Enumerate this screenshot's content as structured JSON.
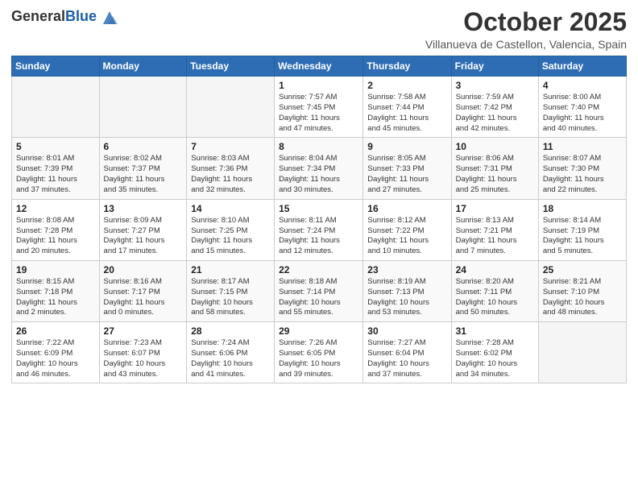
{
  "logo": {
    "general": "General",
    "blue": "Blue"
  },
  "header": {
    "month": "October 2025",
    "location": "Villanueva de Castellon, Valencia, Spain"
  },
  "weekdays": [
    "Sunday",
    "Monday",
    "Tuesday",
    "Wednesday",
    "Thursday",
    "Friday",
    "Saturday"
  ],
  "weeks": [
    [
      {
        "day": "",
        "detail": ""
      },
      {
        "day": "",
        "detail": ""
      },
      {
        "day": "",
        "detail": ""
      },
      {
        "day": "1",
        "detail": "Sunrise: 7:57 AM\nSunset: 7:45 PM\nDaylight: 11 hours\nand 47 minutes."
      },
      {
        "day": "2",
        "detail": "Sunrise: 7:58 AM\nSunset: 7:44 PM\nDaylight: 11 hours\nand 45 minutes."
      },
      {
        "day": "3",
        "detail": "Sunrise: 7:59 AM\nSunset: 7:42 PM\nDaylight: 11 hours\nand 42 minutes."
      },
      {
        "day": "4",
        "detail": "Sunrise: 8:00 AM\nSunset: 7:40 PM\nDaylight: 11 hours\nand 40 minutes."
      }
    ],
    [
      {
        "day": "5",
        "detail": "Sunrise: 8:01 AM\nSunset: 7:39 PM\nDaylight: 11 hours\nand 37 minutes."
      },
      {
        "day": "6",
        "detail": "Sunrise: 8:02 AM\nSunset: 7:37 PM\nDaylight: 11 hours\nand 35 minutes."
      },
      {
        "day": "7",
        "detail": "Sunrise: 8:03 AM\nSunset: 7:36 PM\nDaylight: 11 hours\nand 32 minutes."
      },
      {
        "day": "8",
        "detail": "Sunrise: 8:04 AM\nSunset: 7:34 PM\nDaylight: 11 hours\nand 30 minutes."
      },
      {
        "day": "9",
        "detail": "Sunrise: 8:05 AM\nSunset: 7:33 PM\nDaylight: 11 hours\nand 27 minutes."
      },
      {
        "day": "10",
        "detail": "Sunrise: 8:06 AM\nSunset: 7:31 PM\nDaylight: 11 hours\nand 25 minutes."
      },
      {
        "day": "11",
        "detail": "Sunrise: 8:07 AM\nSunset: 7:30 PM\nDaylight: 11 hours\nand 22 minutes."
      }
    ],
    [
      {
        "day": "12",
        "detail": "Sunrise: 8:08 AM\nSunset: 7:28 PM\nDaylight: 11 hours\nand 20 minutes."
      },
      {
        "day": "13",
        "detail": "Sunrise: 8:09 AM\nSunset: 7:27 PM\nDaylight: 11 hours\nand 17 minutes."
      },
      {
        "day": "14",
        "detail": "Sunrise: 8:10 AM\nSunset: 7:25 PM\nDaylight: 11 hours\nand 15 minutes."
      },
      {
        "day": "15",
        "detail": "Sunrise: 8:11 AM\nSunset: 7:24 PM\nDaylight: 11 hours\nand 12 minutes."
      },
      {
        "day": "16",
        "detail": "Sunrise: 8:12 AM\nSunset: 7:22 PM\nDaylight: 11 hours\nand 10 minutes."
      },
      {
        "day": "17",
        "detail": "Sunrise: 8:13 AM\nSunset: 7:21 PM\nDaylight: 11 hours\nand 7 minutes."
      },
      {
        "day": "18",
        "detail": "Sunrise: 8:14 AM\nSunset: 7:19 PM\nDaylight: 11 hours\nand 5 minutes."
      }
    ],
    [
      {
        "day": "19",
        "detail": "Sunrise: 8:15 AM\nSunset: 7:18 PM\nDaylight: 11 hours\nand 2 minutes."
      },
      {
        "day": "20",
        "detail": "Sunrise: 8:16 AM\nSunset: 7:17 PM\nDaylight: 11 hours\nand 0 minutes."
      },
      {
        "day": "21",
        "detail": "Sunrise: 8:17 AM\nSunset: 7:15 PM\nDaylight: 10 hours\nand 58 minutes."
      },
      {
        "day": "22",
        "detail": "Sunrise: 8:18 AM\nSunset: 7:14 PM\nDaylight: 10 hours\nand 55 minutes."
      },
      {
        "day": "23",
        "detail": "Sunrise: 8:19 AM\nSunset: 7:13 PM\nDaylight: 10 hours\nand 53 minutes."
      },
      {
        "day": "24",
        "detail": "Sunrise: 8:20 AM\nSunset: 7:11 PM\nDaylight: 10 hours\nand 50 minutes."
      },
      {
        "day": "25",
        "detail": "Sunrise: 8:21 AM\nSunset: 7:10 PM\nDaylight: 10 hours\nand 48 minutes."
      }
    ],
    [
      {
        "day": "26",
        "detail": "Sunrise: 7:22 AM\nSunset: 6:09 PM\nDaylight: 10 hours\nand 46 minutes."
      },
      {
        "day": "27",
        "detail": "Sunrise: 7:23 AM\nSunset: 6:07 PM\nDaylight: 10 hours\nand 43 minutes."
      },
      {
        "day": "28",
        "detail": "Sunrise: 7:24 AM\nSunset: 6:06 PM\nDaylight: 10 hours\nand 41 minutes."
      },
      {
        "day": "29",
        "detail": "Sunrise: 7:26 AM\nSunset: 6:05 PM\nDaylight: 10 hours\nand 39 minutes."
      },
      {
        "day": "30",
        "detail": "Sunrise: 7:27 AM\nSunset: 6:04 PM\nDaylight: 10 hours\nand 37 minutes."
      },
      {
        "day": "31",
        "detail": "Sunrise: 7:28 AM\nSunset: 6:02 PM\nDaylight: 10 hours\nand 34 minutes."
      },
      {
        "day": "",
        "detail": ""
      }
    ]
  ]
}
